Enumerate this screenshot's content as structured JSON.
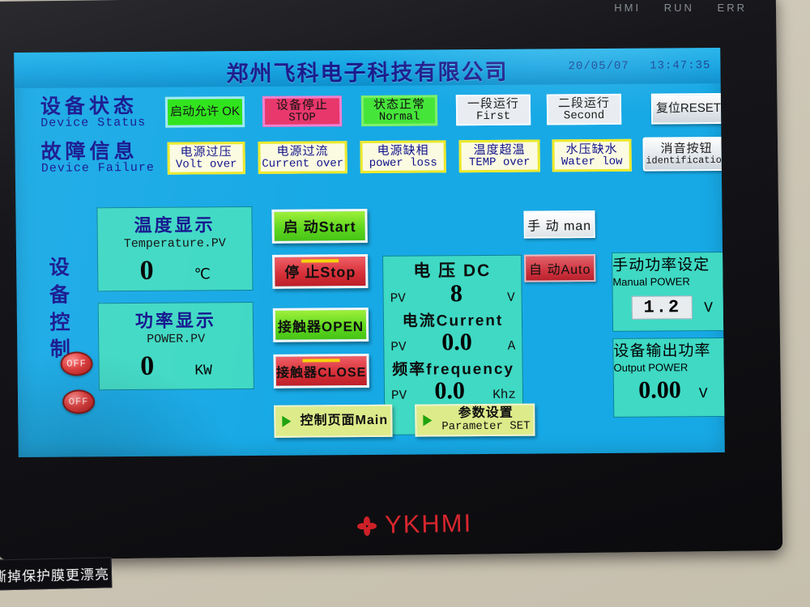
{
  "device": {
    "bezel_labels": [
      "HMI",
      "RUN",
      "ERR"
    ],
    "brand_text": "YKHMI",
    "brand_icon": "flower-mark-icon",
    "sticker_text": "撕掉保护膜更漂亮"
  },
  "screen": {
    "title": "郑州飞科电子科技有限公司",
    "date": "20/05/07",
    "time": "13:47:35"
  },
  "status_row": {
    "label_cn": "设备状态",
    "label_en": "Device Status",
    "items": [
      {
        "cn": "启动允许 OK",
        "en": "",
        "style": "green",
        "single": true
      },
      {
        "cn": "设备停止",
        "en": "STOP",
        "style": "red",
        "single": false
      },
      {
        "cn": "状态正常",
        "en": "Normal",
        "style": "green2",
        "single": false
      },
      {
        "cn": "一段运行",
        "en": "First",
        "style": "gray",
        "single": false
      },
      {
        "cn": "二段运行",
        "en": "Second",
        "style": "gray",
        "single": false
      },
      {
        "cn": "复位RESET",
        "en": "",
        "style": "btn3d",
        "single": true
      }
    ]
  },
  "failure_row": {
    "label_cn": "故障信息",
    "label_en": "Device Failure",
    "items": [
      {
        "cn": "电源过压",
        "en": "Volt over",
        "style": "yellowbox",
        "single": false
      },
      {
        "cn": "电源过流",
        "en": "Current over",
        "style": "yellowbox",
        "single": false
      },
      {
        "cn": "电源缺相",
        "en": "power loss",
        "style": "yellowbox",
        "single": false
      },
      {
        "cn": "温度超温",
        "en": "TEMP over",
        "style": "yellowbox",
        "single": false
      },
      {
        "cn": "水压缺水",
        "en": "Water low",
        "style": "yellowbox",
        "single": false
      },
      {
        "cn": "消音按钮",
        "en": "identification",
        "style": "btn3d",
        "single": false
      }
    ]
  },
  "control_sidebar": {
    "label_chars": [
      "设",
      "备",
      "控",
      "制"
    ],
    "lamps": [
      {
        "text": "OFF",
        "name": "indicator-lamp-1"
      },
      {
        "text": "OFF",
        "name": "indicator-lamp-2"
      }
    ]
  },
  "panels": {
    "temperature": {
      "title_cn": "温度显示",
      "title_en": "Temperature.PV",
      "value": "0",
      "unit": "℃"
    },
    "power": {
      "title_cn": "功率显示",
      "title_en": "POWER.PV",
      "value": "0",
      "unit": "KW"
    },
    "manual_power": {
      "title_cn": "手动功率设定",
      "title_en": "Manual POWER",
      "value": "1.2",
      "unit": "V"
    },
    "output_power": {
      "title_cn": "设备输出功率",
      "title_en": "Output POWER",
      "value": "0.00",
      "unit": "V"
    }
  },
  "measurements": {
    "voltage": {
      "title": "电 压 DC",
      "pv": "PV",
      "value": "8",
      "unit": "V"
    },
    "current": {
      "title": "电流Current",
      "pv": "PV",
      "value": "0.0",
      "unit": "A"
    },
    "frequency": {
      "title": "频率frequency",
      "pv": "PV",
      "value": "0.0",
      "unit": "Khz"
    }
  },
  "action_buttons": [
    {
      "label": "启 动Start",
      "style": "g",
      "bar": false
    },
    {
      "label": "停 止Stop",
      "style": "r",
      "bar": true
    },
    {
      "label": "接触器OPEN",
      "style": "g",
      "bar": false
    },
    {
      "label": "接触器CLOSE",
      "style": "r",
      "bar": true
    }
  ],
  "mode_buttons": [
    {
      "label": "手 动 man",
      "state": "off"
    },
    {
      "label": "自 动Auto",
      "state": "on"
    }
  ],
  "nav_buttons": [
    {
      "cn": "控制页面Main",
      "en": "",
      "single": true
    },
    {
      "cn": "参数设置",
      "en": "Parameter SET",
      "single": false
    }
  ]
}
